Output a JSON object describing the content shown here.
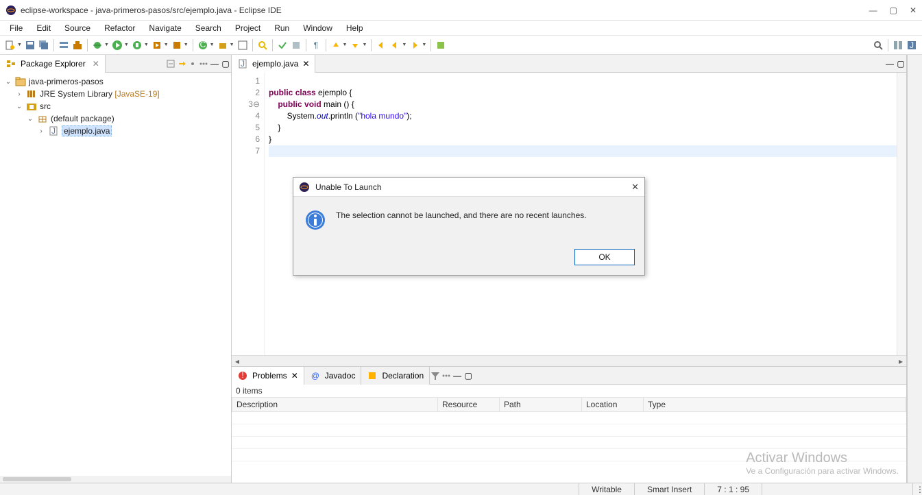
{
  "window": {
    "title": "eclipse-workspace - java-primeros-pasos/src/ejemplo.java - Eclipse IDE"
  },
  "menu": [
    "File",
    "Edit",
    "Source",
    "Refactor",
    "Navigate",
    "Search",
    "Project",
    "Run",
    "Window",
    "Help"
  ],
  "explorer": {
    "title": "Package Explorer",
    "tree": {
      "project": "java-primeros-pasos",
      "jre": "JRE System Library",
      "jre_deco": "[JavaSE-19]",
      "src": "src",
      "pkg": "(default package)",
      "file": "ejemplo.java"
    }
  },
  "editor": {
    "tab": "ejemplo.java",
    "gutter": [
      "1",
      "2",
      "3",
      "4",
      "5",
      "6",
      "7"
    ],
    "gutter3_marker": "⊖",
    "code": {
      "l1": "",
      "l2_kw1": "public",
      "l2_kw2": "class",
      "l2_rest": " ejemplo {",
      "l3_indent": "    ",
      "l3_kw1": "public",
      "l3_kw2": "void",
      "l3_rest": " main () {",
      "l4_indent": "        ",
      "l4_sys": "System.",
      "l4_out": "out",
      "l4_call": ".println (",
      "l4_str": "\"hola mundo\"",
      "l4_end": ");",
      "l5": "    }",
      "l6": "}",
      "l7": ""
    }
  },
  "problems": {
    "tab1": "Problems",
    "tab2": "Javadoc",
    "tab3": "Declaration",
    "count": "0 items",
    "cols": [
      "Description",
      "Resource",
      "Path",
      "Location",
      "Type"
    ]
  },
  "status": {
    "writable": "Writable",
    "insert": "Smart Insert",
    "pos": "7 : 1 : 95"
  },
  "dialog": {
    "title": "Unable To Launch",
    "message": "The selection cannot be launched, and there are no recent launches.",
    "ok": "OK"
  },
  "watermark": {
    "l1": "Activar Windows",
    "l2": "Ve a Configuración para activar Windows."
  }
}
